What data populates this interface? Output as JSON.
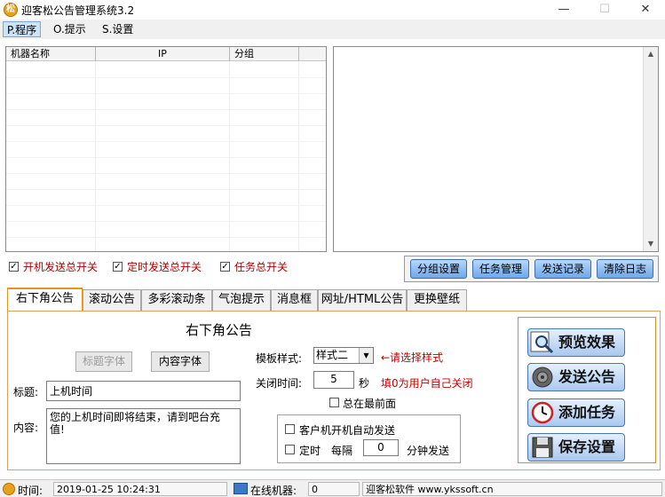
{
  "window": {
    "title": "迎客松公告管理系统3.2"
  },
  "menu": {
    "items": [
      "P.程序",
      "O.提示",
      "S.设置"
    ]
  },
  "machine_list": {
    "columns": [
      "机器名称",
      "IP",
      "分组"
    ]
  },
  "checkboxes": [
    {
      "label": "开机发送总开关",
      "checked": true
    },
    {
      "label": "定时发送总开关",
      "checked": true
    },
    {
      "label": "任务总开关",
      "checked": true
    }
  ],
  "group_buttons": [
    "分组设置",
    "任务管理",
    "发送记录",
    "清除日志"
  ],
  "tabs": [
    "右下角公告",
    "滚动公告",
    "多彩滚动条",
    "气泡提示",
    "消息框",
    "网址/HTML公告",
    "更换壁纸"
  ],
  "panel": {
    "title": "右下角公告",
    "title_font_button": "标题字体",
    "content_font_button": "内容字体",
    "title_label": "标题:",
    "title_value": "上机时间",
    "content_label": "内容:",
    "content_value": "您的上机时间即将结束，请到吧台充值!",
    "template_label": "模板样式:",
    "template_value": "样式二",
    "template_hint": "←请选择样式",
    "close_label": "关闭时间:",
    "close_value": "5",
    "close_unit": "秒",
    "close_hint": "填0为用户自己关闭",
    "always_on_top": "总在最前面",
    "auto_send": "客户机开机自动发送",
    "timed": "定时",
    "every": "每隔",
    "interval_value": "0",
    "interval_unit": "分钟发送"
  },
  "actions": [
    "预览效果",
    "发送公告",
    "添加任务",
    "保存设置"
  ],
  "status": {
    "time_label": "时间:",
    "time_value": "2019-01-25 10:24:31",
    "online_label": "在线机器:",
    "online_value": "0",
    "company": "迎客松软件 www.ykssoft.cn"
  }
}
